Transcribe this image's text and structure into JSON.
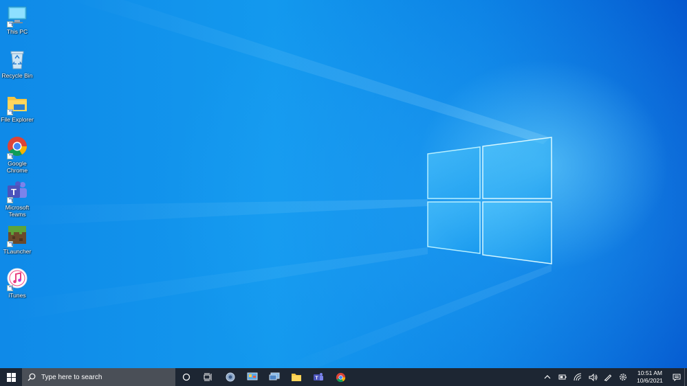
{
  "desktop": {
    "icons": [
      {
        "label": "This PC",
        "icon": "this-pc-icon"
      },
      {
        "label": "Recycle Bin",
        "icon": "recycle-bin-icon"
      },
      {
        "label": "File Explorer",
        "icon": "file-explorer-icon"
      },
      {
        "label": "Google Chrome",
        "icon": "chrome-icon"
      },
      {
        "label": "Microsoft Teams",
        "icon": "teams-icon"
      },
      {
        "label": "TLauncher",
        "icon": "tlauncher-icon"
      },
      {
        "label": "iTunes",
        "icon": "itunes-icon"
      }
    ]
  },
  "taskbar": {
    "search_placeholder": "Type here to search",
    "pinned": [
      "cortana-icon",
      "task-view-icon",
      "settings-icon",
      "control-panel-icon",
      "remote-desktop-icon",
      "file-explorer-icon",
      "teams-icon",
      "chrome-icon"
    ],
    "tray": [
      "show-hidden-icon",
      "battery-icon",
      "wifi-icon",
      "volume-icon",
      "pen-icon",
      "settings-icon"
    ],
    "clock_time": "10:51 AM",
    "clock_date": "10/6/2021"
  },
  "colors": {
    "taskbar_bg": "#1d2633",
    "wallpaper_accent": "#0a78d8"
  }
}
